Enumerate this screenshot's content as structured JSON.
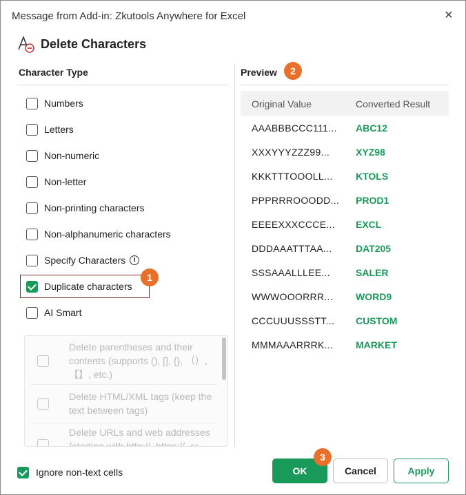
{
  "window": {
    "title": "Message from Add-in: Zkutools Anywhere for Excel",
    "close_glyph": "✕"
  },
  "header": {
    "heading": "Delete Characters",
    "icon": "delete-characters-icon"
  },
  "character_type": {
    "label": "Character Type",
    "options": [
      {
        "label": "Numbers",
        "checked": false
      },
      {
        "label": "Letters",
        "checked": false
      },
      {
        "label": "Non-numeric",
        "checked": false
      },
      {
        "label": "Non-letter",
        "checked": false
      },
      {
        "label": "Non-printing characters",
        "checked": false
      },
      {
        "label": "Non-alphanumeric characters",
        "checked": false
      },
      {
        "label": "Specify Characters",
        "checked": false,
        "info": "i"
      },
      {
        "label": "Duplicate characters",
        "checked": true
      },
      {
        "label": "AI Smart",
        "checked": false
      }
    ],
    "ai_options": [
      "Delete parentheses and their contents (supports (), [], {}, （）, 【】, etc.)",
      "Delete HTML/XML tags (keep the text between tags)",
      "Delete URLs and web addresses (starting with http://, https://, or"
    ]
  },
  "preview": {
    "label": "Preview",
    "columns": [
      "Original Value",
      "Converted Result"
    ],
    "rows": [
      {
        "original": "AAABBBCCC111...",
        "converted": "ABC12"
      },
      {
        "original": "XXXYYYZZZ99...",
        "converted": "XYZ98"
      },
      {
        "original": "KKKTTTOOOLL...",
        "converted": "KTOLS"
      },
      {
        "original": "PPPRRROOODD...",
        "converted": "PROD1"
      },
      {
        "original": "EEEEXXXCCCE...",
        "converted": "EXCL"
      },
      {
        "original": "DDDAAATTTAA...",
        "converted": "DAT205"
      },
      {
        "original": "SSSAAALLLEE...",
        "converted": "SALER"
      },
      {
        "original": "WWWOOORRR...",
        "converted": "WORD9"
      },
      {
        "original": "CCCUUUSSSTT...",
        "converted": "CUSTOM"
      },
      {
        "original": "MMMAAARRRK...",
        "converted": "MARKET"
      }
    ]
  },
  "footer": {
    "ignore_label": "Ignore non-text cells",
    "ignore_checked": true,
    "ok_label": "OK",
    "cancel_label": "Cancel",
    "apply_label": "Apply"
  },
  "badges": [
    "1",
    "2",
    "3"
  ],
  "colors": {
    "accent": "#1a9a5a",
    "badge": "#e8702a",
    "highlight_border": "#7a2a2a"
  }
}
